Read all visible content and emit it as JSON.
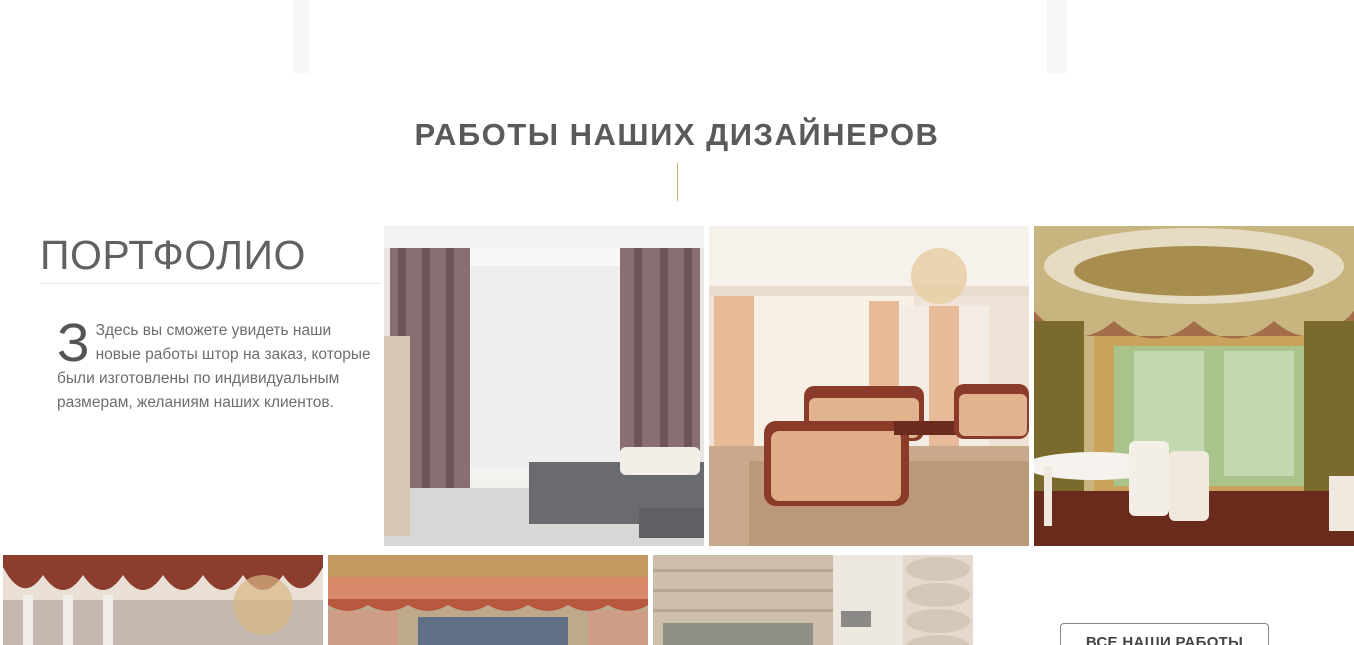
{
  "section": {
    "title": "РАБОТЫ НАШИХ ДИЗАЙНЕРОВ",
    "accent_color": "#c9b36a"
  },
  "portfolio": {
    "heading": "ПОРТФОЛИО",
    "dropcap": "З",
    "description": "Здесь вы сможете увидеть наши новые работы штор на заказ, которые были изготовлены по индивидуальным размерам, желаниям наших клиентов."
  },
  "gallery": {
    "photos": [
      {
        "name": "modern-living-room-curtains",
        "icon": "photo-icon"
      },
      {
        "name": "classic-salon-beige-drapes",
        "icon": "photo-icon"
      },
      {
        "name": "dining-room-swag-curtains",
        "icon": "photo-icon"
      },
      {
        "name": "burgundy-austrian-valance",
        "icon": "photo-icon"
      },
      {
        "name": "floral-valance-window",
        "icon": "photo-icon"
      },
      {
        "name": "log-house-curtains",
        "icon": "photo-icon"
      }
    ]
  },
  "cta": {
    "all_works_label": "ВСЕ НАШИ РАБОТЫ"
  }
}
